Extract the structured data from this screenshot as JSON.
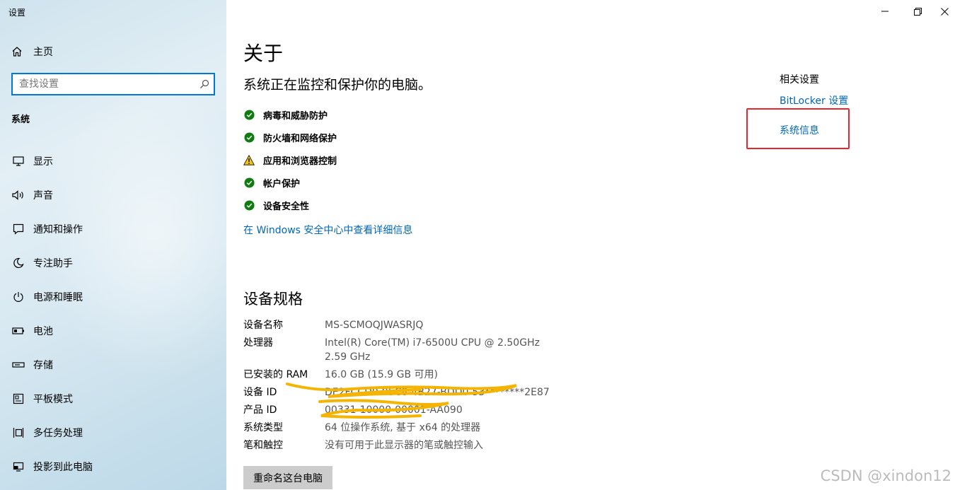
{
  "window": {
    "title": "设置"
  },
  "sidebar": {
    "home_label": "主页",
    "search_placeholder": "查找设置",
    "section_title": "系统",
    "items": [
      {
        "label": "显示",
        "icon": "monitor-icon"
      },
      {
        "label": "声音",
        "icon": "speaker-icon"
      },
      {
        "label": "通知和操作",
        "icon": "message-icon"
      },
      {
        "label": "专注助手",
        "icon": "moon-icon"
      },
      {
        "label": "电源和睡眠",
        "icon": "power-icon"
      },
      {
        "label": "电池",
        "icon": "battery-icon"
      },
      {
        "label": "存储",
        "icon": "storage-icon"
      },
      {
        "label": "平板模式",
        "icon": "tablet-icon"
      },
      {
        "label": "多任务处理",
        "icon": "multitask-icon"
      },
      {
        "label": "投影到此电脑",
        "icon": "project-icon"
      }
    ]
  },
  "main": {
    "title": "关于",
    "protection_heading": "系统正在监控和保护你的电脑。",
    "status_items": [
      {
        "label": "病毒和威胁防护",
        "status": "ok"
      },
      {
        "label": "防火墙和网络保护",
        "status": "ok"
      },
      {
        "label": "应用和浏览器控制",
        "status": "warning"
      },
      {
        "label": "帐户保护",
        "status": "ok"
      },
      {
        "label": "设备安全性",
        "status": "ok"
      }
    ],
    "security_link": "在 Windows 安全中心中查看详细信息",
    "specs_title": "设备规格",
    "specs": [
      {
        "key": "设备名称",
        "value": "MS-SCMOQJWASRJQ"
      },
      {
        "key": "处理器",
        "value": "Intel(R) Core(TM) i7-6500U CPU @ 2.50GHz   2.59 GHz"
      },
      {
        "key": "已安装的 RAM",
        "value": "16.0 GB (15.9 GB 可用)"
      },
      {
        "key": "设备 ID",
        "value": "DE2FCCD0-95C8-4B27-BDD0-53********2E87"
      },
      {
        "key": "产品 ID",
        "value": "00331-10000-00001-AA090"
      },
      {
        "key": "系统类型",
        "value": "64 位操作系统, 基于 x64 的处理器"
      },
      {
        "key": "笔和触控",
        "value": "没有可用于此显示器的笔或触控输入"
      }
    ],
    "rename_button": "重命名这台电脑"
  },
  "related": {
    "title": "相关设置",
    "links": [
      "BitLocker 设置",
      "系统信息"
    ]
  },
  "colors": {
    "accent": "#0078d7",
    "link": "#0067b8",
    "ok": "#107c10",
    "warning": "#f7c600",
    "highlight": "#e8262c",
    "scribble": "#f5b400"
  },
  "watermark": "CSDN @xindon12"
}
